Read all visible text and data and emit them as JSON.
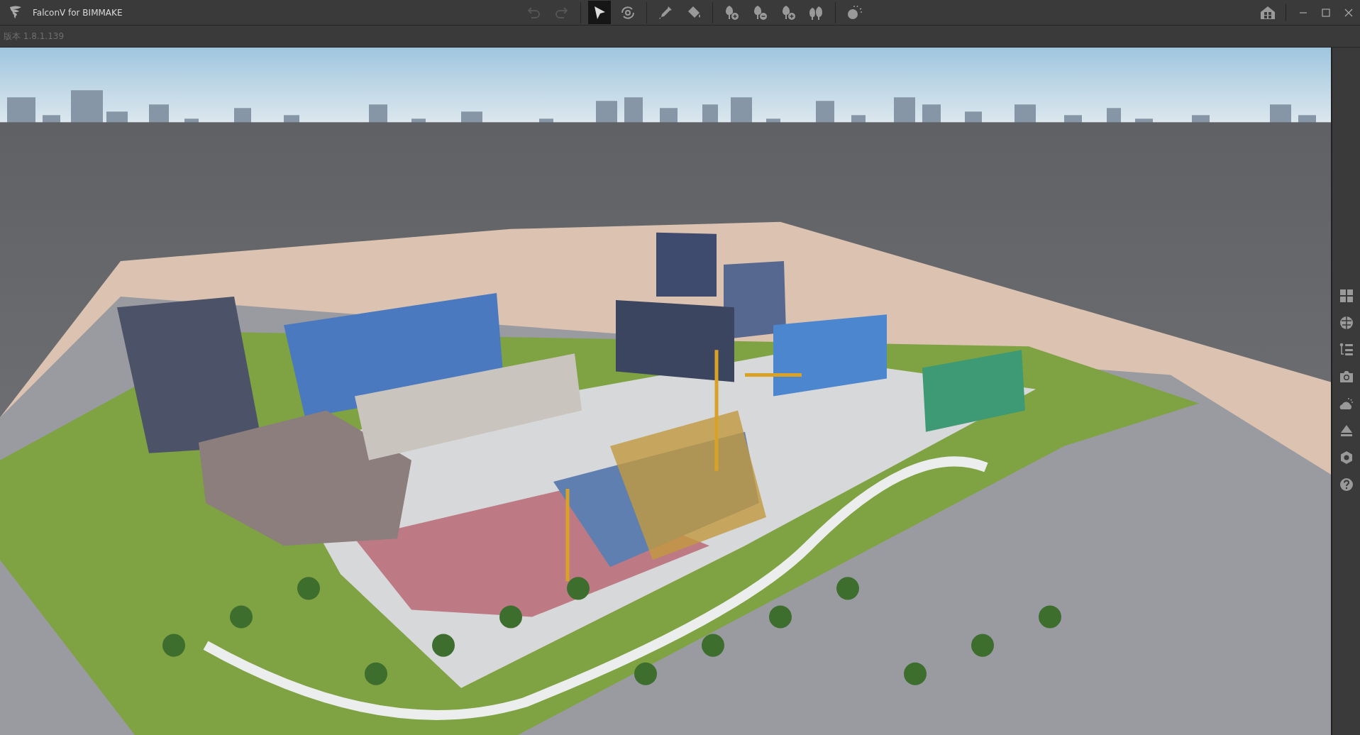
{
  "window": {
    "title": "FalconV for BIMMAKE"
  },
  "version_label": "版本 1.8.1.139",
  "toolbar": {
    "groups": [
      [
        {
          "disabled": true,
          "selected": false
        },
        {
          "disabled": true,
          "selected": false
        }
      ],
      [
        {
          "disabled": false,
          "selected": true
        },
        {
          "disabled": false,
          "selected": false
        }
      ],
      [
        {
          "disabled": false,
          "selected": false
        },
        {
          "disabled": false,
          "selected": false
        }
      ],
      [
        {
          "disabled": false,
          "selected": false
        },
        {
          "disabled": false,
          "selected": false
        },
        {
          "disabled": false,
          "selected": false
        },
        {
          "disabled": false,
          "selected": false
        }
      ],
      [
        {
          "disabled": false,
          "selected": false
        }
      ]
    ]
  }
}
